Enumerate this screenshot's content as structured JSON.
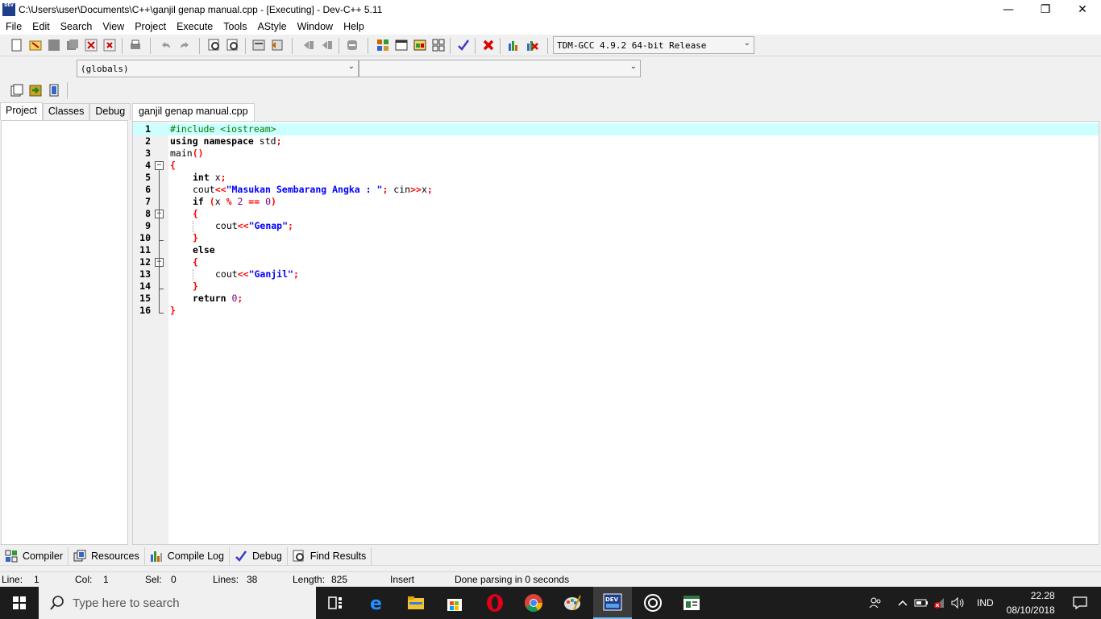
{
  "window": {
    "title": "C:\\Users\\user\\Documents\\C++\\ganjil genap manual.cpp - [Executing] - Dev-C++ 5.11",
    "app_icon_text": "DEV"
  },
  "menu": [
    "File",
    "Edit",
    "Search",
    "View",
    "Project",
    "Execute",
    "Tools",
    "AStyle",
    "Window",
    "Help"
  ],
  "toolbar": {
    "compiler_select": "TDM-GCC 4.9.2 64-bit Release",
    "scope_select": "(globals)",
    "member_select": ""
  },
  "left_tabs": [
    "Project",
    "Classes",
    "Debug"
  ],
  "editor": {
    "tab_label": "ganjil genap manual.cpp",
    "line_numbers": [
      "1",
      "2",
      "3",
      "4",
      "5",
      "6",
      "7",
      "8",
      "9",
      "10",
      "11",
      "12",
      "13",
      "14",
      "15",
      "16"
    ]
  },
  "code": {
    "l1": "#include <iostream>",
    "l2_kw": "using namespace",
    "l2_rest": " std",
    "l2_semi": ";",
    "l3_name": "main",
    "l3_paren": "()",
    "l4": "{",
    "l5_kw": "int",
    "l5_rest": " x",
    "l5_semi": ";",
    "l6_a": "cout",
    "l6_b": "<<",
    "l6_str": "\"Masukan Sembarang Angka : \"",
    "l6_c": "; ",
    "l6_d": "cin",
    "l6_e": ">>",
    "l6_f": "x",
    "l6_g": ";",
    "l7_kw": "if",
    "l7_a": " (",
    "l7_b": "x ",
    "l7_c": "%",
    "l7_d": " 2 ",
    "l7_e": "==",
    "l7_f": " 0",
    "l7_g": ")",
    "l8": "{",
    "l9_a": "cout",
    "l9_b": "<<",
    "l9_str": "\"Genap\"",
    "l9_c": ";",
    "l10": "}",
    "l11_kw": "else",
    "l12": "{",
    "l13_a": "cout",
    "l13_b": "<<",
    "l13_str": "\"Ganjil\"",
    "l13_c": ";",
    "l14": "}",
    "l15_kw": "return",
    "l15_num": " 0",
    "l15_semi": ";",
    "l16": "}"
  },
  "bottom_tabs": [
    "Compiler",
    "Resources",
    "Compile Log",
    "Debug",
    "Find Results"
  ],
  "status": {
    "line_label": "Line:",
    "line_value": "1",
    "col_label": "Col:",
    "col_value": "1",
    "sel_label": "Sel:",
    "sel_value": "0",
    "lines_label": "Lines:",
    "lines_value": "38",
    "length_label": "Length:",
    "length_value": "825",
    "mode": "Insert",
    "message": "Done parsing in 0 seconds"
  },
  "taskbar": {
    "search_placeholder": "Type here to search",
    "language": "IND",
    "time": "22.28",
    "date": "08/10/2018"
  }
}
